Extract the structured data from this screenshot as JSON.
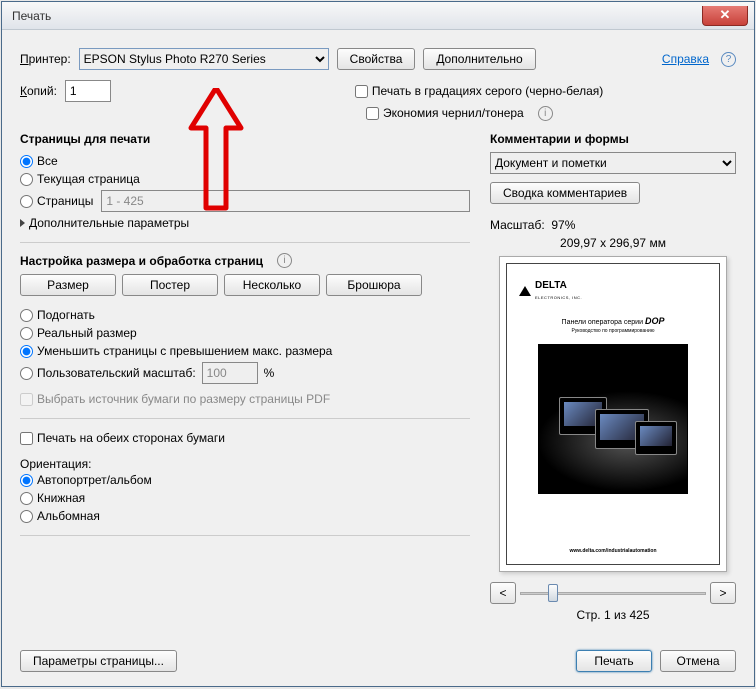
{
  "window": {
    "title": "Печать"
  },
  "header": {
    "printer_label": "Принтер:",
    "printer_value": "EPSON Stylus Photo R270 Series",
    "properties_btn": "Свойства",
    "advanced_btn": "Дополнительно",
    "help_link": "Справка",
    "copies_label": "Копий:",
    "copies_value": "1",
    "grayscale_label": "Печать в градациях серого (черно-белая)",
    "ink_label": "Экономия чернил/тонера"
  },
  "pages": {
    "title": "Страницы для печати",
    "all": "Все",
    "current": "Текущая страница",
    "range_label": "Страницы",
    "range_placeholder": "1 - 425",
    "more": "Дополнительные параметры"
  },
  "sizing": {
    "title": "Настройка размера и обработка страниц",
    "size_btn": "Размер",
    "poster_btn": "Постер",
    "multiple_btn": "Несколько",
    "booklet_btn": "Брошюра",
    "fit": "Подогнать",
    "actual": "Реальный размер",
    "shrink": "Уменьшить страницы с превышением макс. размера",
    "custom_label": "Пользовательский масштаб:",
    "custom_value": "100",
    "percent": "%",
    "choose_source": "Выбрать источник бумаги по размеру страницы PDF",
    "duplex": "Печать на обеих сторонах бумаги",
    "orientation_label": "Ориентация:",
    "orient_auto": "Автопортрет/альбом",
    "orient_portrait": "Книжная",
    "orient_landscape": "Альбомная"
  },
  "comments": {
    "title": "Комментарии и формы",
    "dropdown_value": "Документ и пометки",
    "summary_btn": "Сводка комментариев"
  },
  "preview": {
    "scale_label": "Масштаб:",
    "scale_value": "97%",
    "paper_dims": "209,97 x 296,97 мм",
    "doc_brand": "DELTA",
    "doc_brand_sub": "ELECTRONICS, INC.",
    "doc_title": "Панели оператора серии",
    "doc_title_suffix": "DOP",
    "doc_subtitle": "Руководство по программированию",
    "doc_url": "www.delta.com/industrialautomation",
    "page_counter": "Стр. 1 из 425"
  },
  "footer": {
    "page_setup_btn": "Параметры страницы...",
    "print_btn": "Печать",
    "cancel_btn": "Отмена"
  }
}
